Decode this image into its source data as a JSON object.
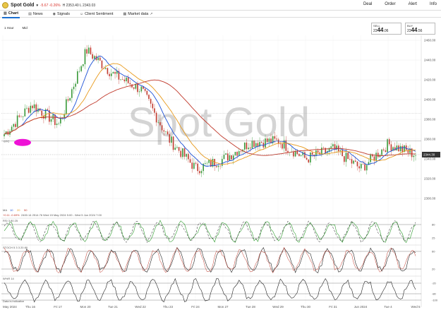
{
  "header": {
    "instrument": "Spot Gold",
    "change": "-5.67 -0.26%",
    "high_low": "H 2353.40  L 2343.03",
    "menu": [
      "Deal",
      "Order",
      "Alert",
      "Info"
    ]
  },
  "tabs": [
    {
      "label": "Chart",
      "icon": "chart-icon"
    },
    {
      "label": "News",
      "icon": "news-icon"
    },
    {
      "label": "Signals",
      "icon": "signals-icon"
    },
    {
      "label": "Client Sentiment",
      "icon": "sentiment-icon"
    },
    {
      "label": "Market data",
      "icon": "external-link-icon"
    }
  ],
  "toolbar": {
    "interval": "1 Hour",
    "type": "Mid"
  },
  "quote": {
    "sell_label": "SELL",
    "sell_prefix": "23",
    "sell_big": "44",
    "sell_suffix": ".06",
    "buy_label": "BUY",
    "buy_prefix": "23",
    "buy_big": "44",
    "buy_suffix": ".56"
  },
  "watermark": "Spot Gold",
  "price_axis": {
    "ticks": [
      "2460.00",
      "2440.00",
      "2420.00",
      "2400.00",
      "2380.00",
      "2360.00",
      "2340.00",
      "2320.00",
      "2300.00"
    ],
    "current_price": "2344.30"
  },
  "gtc_label": "GTC",
  "ma_legend": {
    "label": "MA",
    "periods": [
      "10",
      "20",
      "50"
    ],
    "colors": [
      "#222222",
      "#1a4fd6",
      "#e89a1c",
      "#c0392b"
    ]
  },
  "ma_values": "2400.14   2514.76   Wed 15 May 2024 5:00 - Wed 5 Jun 2024 7:00",
  "ma_sub": "+0.11   -0.69%",
  "indicators": [
    {
      "name": "RSI  3  80  25",
      "levels": [
        "80",
        "25"
      ]
    },
    {
      "name": "STOCH  5  3  3  20  80",
      "levels": [
        "60",
        "20"
      ]
    },
    {
      "name": "W%R  14",
      "levels": [
        "-20",
        "-80",
        "-100"
      ]
    }
  ],
  "indicator_footer": "Data is indicative",
  "date_axis": [
    "May 2024",
    "Thu 16",
    "Fri 17",
    "Mon 20",
    "Tue 21",
    "Wed 22",
    "Thu 23",
    "Fri 24",
    "Mon 27",
    "Tue 28",
    "Wed 29",
    "Thu 30",
    "Fri 31",
    "Jun 2024",
    "Tue 4",
    "Wed 5"
  ],
  "chart_data": {
    "type": "candlestick",
    "title": "Spot Gold",
    "ylim": [
      2300,
      2460
    ],
    "x": [
      "May 2024",
      "Thu 16",
      "Fri 17",
      "Mon 20",
      "Tue 21",
      "Wed 22",
      "Thu 23",
      "Fri 24",
      "Mon 27",
      "Tue 28",
      "Wed 29",
      "Thu 30",
      "Fri 31",
      "Jun 2024",
      "Tue 4",
      "Wed 5"
    ],
    "close": [
      2365,
      2395,
      2375,
      2450,
      2425,
      2410,
      2360,
      2330,
      2340,
      2357,
      2358,
      2340,
      2350,
      2330,
      2355,
      2344.3
    ],
    "series": [
      {
        "name": "MA 10",
        "color": "#1a4fd6"
      },
      {
        "name": "MA 20",
        "color": "#e89a1c"
      },
      {
        "name": "MA 50",
        "color": "#c0392b"
      }
    ]
  }
}
